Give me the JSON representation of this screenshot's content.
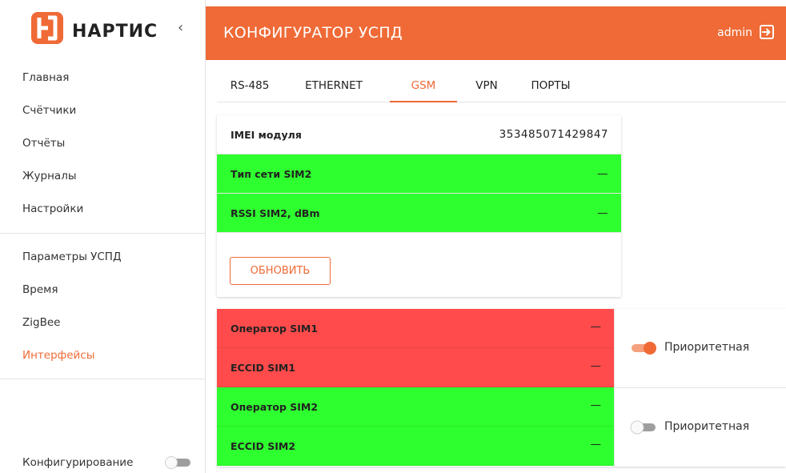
{
  "brand": {
    "name": "НАРТИС",
    "accent": "#ef6a36"
  },
  "header": {
    "title": "КОНФИГУРАТОР УСПД",
    "user": "admin"
  },
  "sidebar": {
    "collapse_glyph": "‹",
    "group1": [
      {
        "label": "Главная"
      },
      {
        "label": "Счётчики"
      },
      {
        "label": "Отчёты"
      },
      {
        "label": "Журналы"
      },
      {
        "label": "Настройки"
      }
    ],
    "group2": [
      {
        "label": "Параметры УСПД"
      },
      {
        "label": "Время"
      },
      {
        "label": "ZigBee"
      },
      {
        "label": "Интерфейсы",
        "active": true
      }
    ],
    "config_label": "Конфигурирование",
    "config_enabled": false
  },
  "tabs": [
    {
      "label": "RS-485"
    },
    {
      "label": "ETHERNET"
    },
    {
      "label": "GSM",
      "active": true
    },
    {
      "label": "VPN"
    },
    {
      "label": "ПОРТЫ"
    }
  ],
  "module": {
    "imei_label": "IMEI модуля",
    "imei_value": "353485071429847",
    "net_type_label": "Тип сети SIM2",
    "net_type_value": "—",
    "rssi_label": "RSSI SIM2, dBm",
    "rssi_value": "—",
    "refresh_label": "ОБНОВИТЬ"
  },
  "sims": [
    {
      "status_color": "#ff4b4b",
      "operator_label": "Оператор SIM1",
      "operator_value": "—",
      "iccid_label": "ECCID SIM1",
      "iccid_value": "—",
      "priority_label": "Приоритетная",
      "priority": true
    },
    {
      "status_color": "#2eff2e",
      "operator_label": "Оператор SIM2",
      "operator_value": "—",
      "iccid_label": "ECCID SIM2",
      "iccid_value": "—",
      "priority_label": "Приоритетная",
      "priority": false
    }
  ]
}
